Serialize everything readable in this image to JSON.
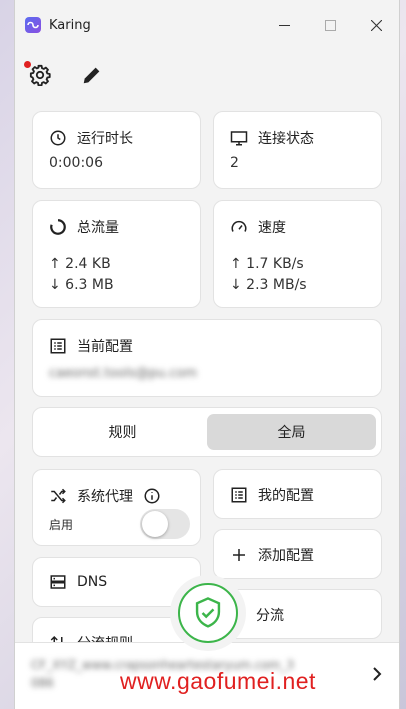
{
  "app": {
    "title": "Karing"
  },
  "cards": {
    "runtime": {
      "label": "运行时长",
      "value": "0:00:06"
    },
    "connections": {
      "label": "连接状态",
      "value": "2"
    },
    "traffic": {
      "label": "总流量",
      "up": "↑ 2.4 KB",
      "down": "↓ 6.3 MB"
    },
    "speed": {
      "label": "速度",
      "up": "↑ 1.7 KB/s",
      "down": "↓ 2.3 MB/s"
    },
    "current_profile": {
      "label": "当前配置",
      "value": "caeonst.tools@pu.com"
    }
  },
  "mode_segment": {
    "rule_label": "规则",
    "global_label": "全局",
    "selected": "全局"
  },
  "system_proxy": {
    "label": "系统代理",
    "sub_label": "启用",
    "enabled": false
  },
  "actions": {
    "my_profiles": "我的配置",
    "add_profile": "添加配置",
    "dns": "DNS",
    "split": "分流",
    "split_rules": "分流规则"
  },
  "bottom": {
    "line1": "CF_XYZ_www.crapsonheartestaryum.com_3",
    "line2": "086"
  },
  "watermark": "www.gaofumei.net",
  "colors": {
    "accent_green": "#3cb54a",
    "notification_red": "#e02020"
  }
}
